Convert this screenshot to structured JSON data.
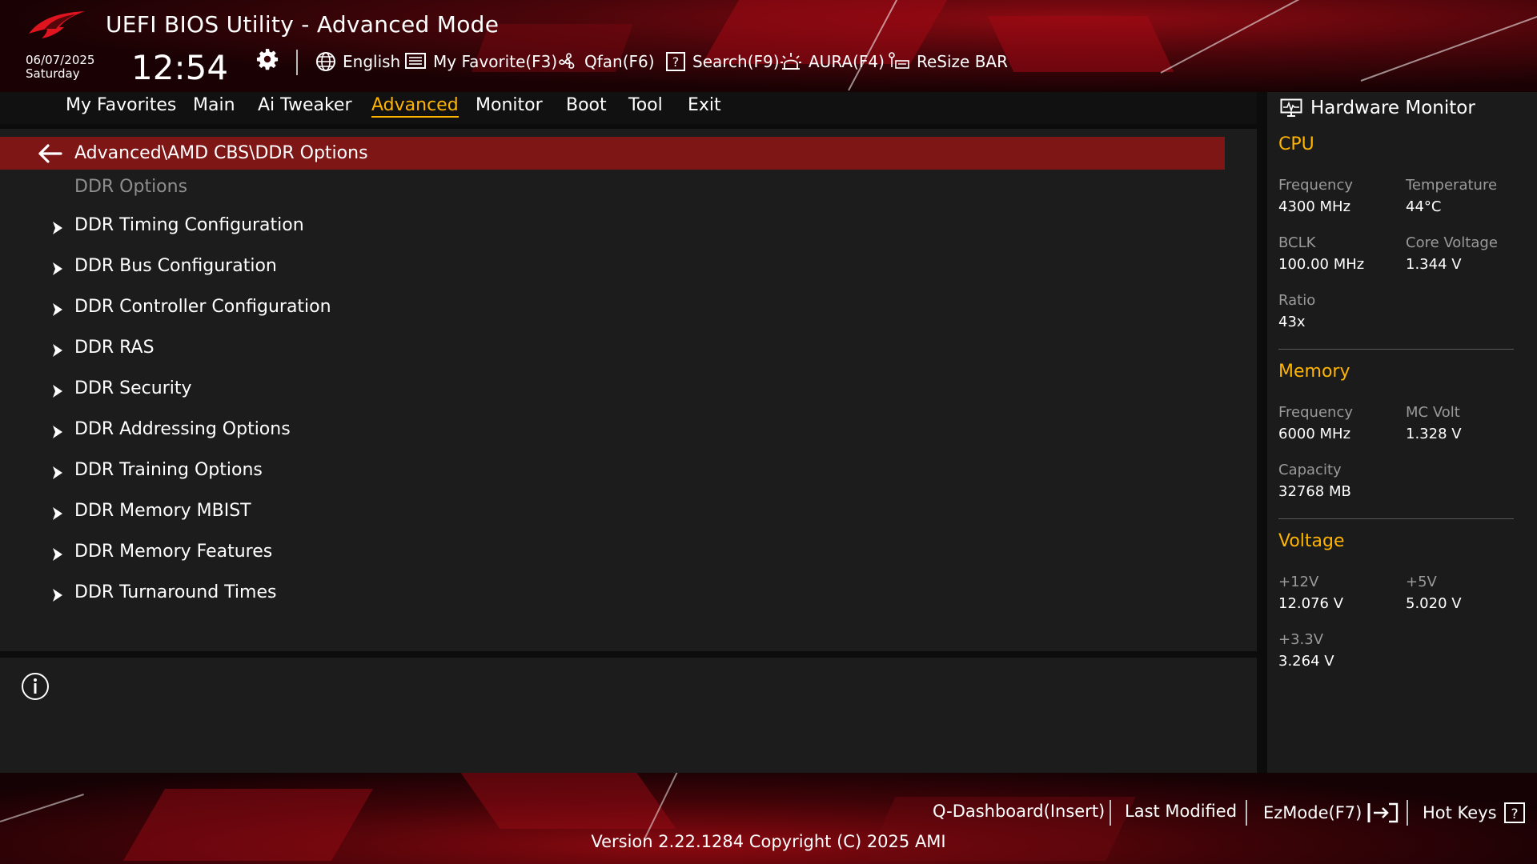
{
  "app": {
    "title": "UEFI BIOS Utility - Advanced Mode"
  },
  "status": {
    "date": "06/07/2025",
    "day": "Saturday",
    "time": "12:54"
  },
  "toolbar": {
    "language": "English",
    "favorite": "My Favorite(F3)",
    "qfan": "Qfan(F6)",
    "search": "Search(F9)",
    "aura": "AURA(F4)",
    "resize_bar": "ReSize BAR"
  },
  "nav": {
    "tabs": [
      {
        "label": "My Favorites",
        "active": false
      },
      {
        "label": "Main",
        "active": false
      },
      {
        "label": "Ai Tweaker",
        "active": false
      },
      {
        "label": "Advanced",
        "active": true
      },
      {
        "label": "Monitor",
        "active": false
      },
      {
        "label": "Boot",
        "active": false
      },
      {
        "label": "Tool",
        "active": false
      },
      {
        "label": "Exit",
        "active": false
      }
    ]
  },
  "main": {
    "breadcrumb": "Advanced\\AMD CBS\\DDR Options",
    "section_label": "DDR Options",
    "items": [
      "DDR Timing Configuration",
      "DDR Bus Configuration",
      "DDR Controller Configuration",
      "DDR RAS",
      "DDR Security",
      "DDR Addressing Options",
      "DDR Training Options",
      "DDR Memory MBIST",
      "DDR Memory Features",
      "DDR Turnaround Times"
    ]
  },
  "hardware_monitor": {
    "title": "Hardware Monitor",
    "cpu": {
      "heading": "CPU",
      "frequency_label": "Frequency",
      "frequency": "4300 MHz",
      "temperature_label": "Temperature",
      "temperature": "44°C",
      "bclk_label": "BCLK",
      "bclk": "100.00 MHz",
      "core_voltage_label": "Core Voltage",
      "core_voltage": "1.344 V",
      "ratio_label": "Ratio",
      "ratio": "43x"
    },
    "memory": {
      "heading": "Memory",
      "frequency_label": "Frequency",
      "frequency": "6000 MHz",
      "mc_volt_label": "MC Volt",
      "mc_volt": "1.328 V",
      "capacity_label": "Capacity",
      "capacity": "32768 MB"
    },
    "voltage": {
      "heading": "Voltage",
      "v12_label": "+12V",
      "v12": "12.076 V",
      "v5_label": "+5V",
      "v5": "5.020 V",
      "v33_label": "+3.3V",
      "v33": "3.264 V"
    }
  },
  "footer": {
    "qdashboard": "Q-Dashboard(Insert)",
    "last_modified": "Last Modified",
    "ezmode": "EzMode(F7)",
    "hotkeys": "Hot Keys",
    "version": "Version 2.22.1284 Copyright (C) 2025 AMI"
  },
  "colors": {
    "accent": "#ffb400",
    "brand_red": "#7e1616",
    "panel": "#1c1c1c",
    "muted": "#8e8e8e"
  },
  "icons": [
    "rog-logo",
    "gear-icon",
    "globe-icon",
    "favorite-list-icon",
    "fan-icon",
    "search-help-icon",
    "aura-icon",
    "resize-bar-icon",
    "monitor-icon",
    "back-arrow-icon",
    "chevron-right-icon",
    "info-icon",
    "ezmode-exit-icon",
    "help-box-icon"
  ]
}
